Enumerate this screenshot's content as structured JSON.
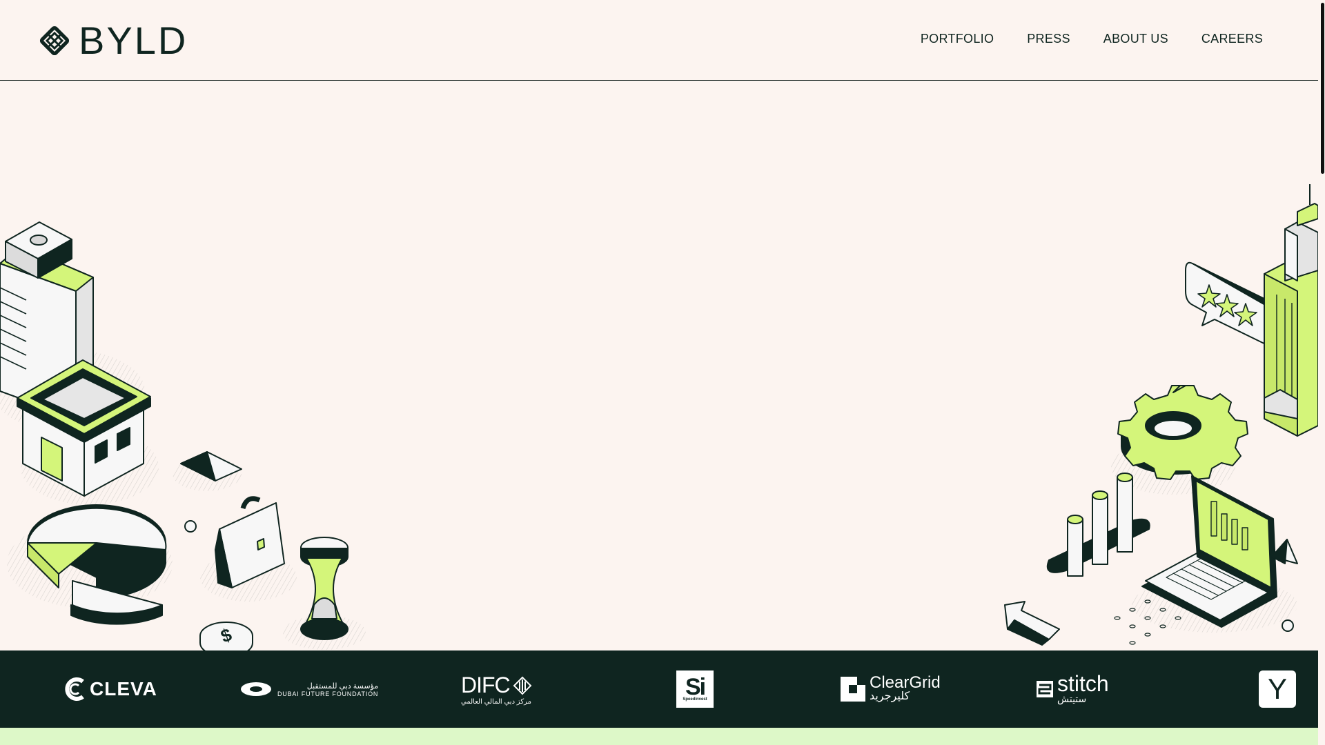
{
  "brand": {
    "name": "BYLD"
  },
  "nav": {
    "items": [
      {
        "label": "PORTFOLIO"
      },
      {
        "label": "PRESS"
      },
      {
        "label": "ABOUT US"
      },
      {
        "label": "CAREERS"
      }
    ]
  },
  "hero": {
    "scroll_icon": "arrow-down-icon",
    "illustration": "isometric-business-illustration"
  },
  "partners": [
    {
      "id": "cleva",
      "label": "CLEVA"
    },
    {
      "id": "dubai-future-foundation",
      "label_ar": "مؤسسة دبي للمستقبل",
      "label_en": "DUBAI FUTURE FOUNDATION"
    },
    {
      "id": "difc",
      "label": "DIFC",
      "label_ar": "مركز دبي المالي العالمي"
    },
    {
      "id": "speedinvest",
      "label": "Si",
      "sublabel": "Speedinvest"
    },
    {
      "id": "cleargrid",
      "label": "ClearGrid",
      "label_ar": "كليرجريد"
    },
    {
      "id": "stitch",
      "label": "stitch",
      "label_ar": "ستيتش"
    },
    {
      "id": "ycombinator",
      "label": "Y"
    }
  ],
  "colors": {
    "background": "#fcf4f0",
    "dark": "#0f2520",
    "accent": "#d4f57a",
    "band": "#ddf8c8"
  }
}
